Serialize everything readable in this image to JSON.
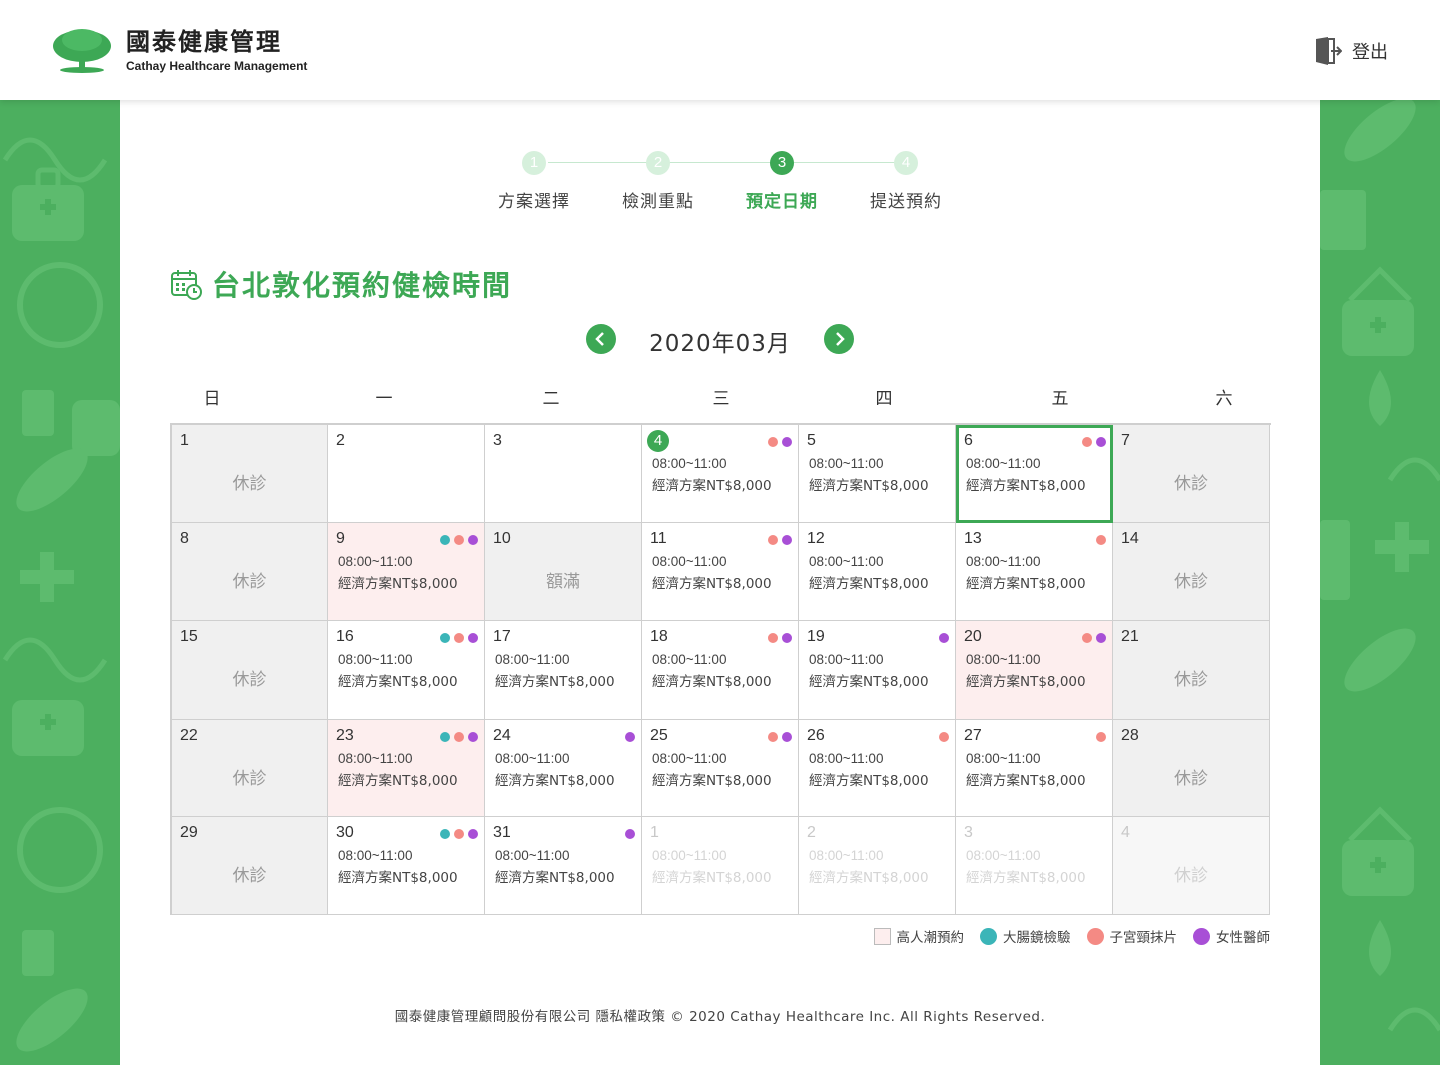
{
  "header": {
    "logo_zh": "國泰健康管理",
    "logo_en": "Cathay Healthcare Management",
    "logout_label": "登出"
  },
  "steps": [
    {
      "num": "1",
      "label": "方案選擇",
      "active": false
    },
    {
      "num": "2",
      "label": "檢測重點",
      "active": false
    },
    {
      "num": "3",
      "label": "預定日期",
      "active": true
    },
    {
      "num": "4",
      "label": "提送預約",
      "active": false
    }
  ],
  "title": "台北敦化預約健檢時間",
  "month_label": "2020年03月",
  "weekdays": [
    "日",
    "一",
    "二",
    "三",
    "四",
    "五",
    "六"
  ],
  "colors": {
    "accent": "#3da855",
    "teal": "#3bb5b8",
    "salmon": "#f48a84",
    "purple": "#a84fd6",
    "crowd": "#fdeeee",
    "closed": "#f0f0f0"
  },
  "calendar": {
    "closed_label": "休診",
    "full_label": "額滿",
    "cells": [
      {
        "day": "1",
        "type": "closed"
      },
      {
        "day": "2",
        "type": "empty"
      },
      {
        "day": "3",
        "type": "empty"
      },
      {
        "day": "4",
        "type": "slot",
        "today": true,
        "dots": [
          "salmon",
          "purple"
        ],
        "time": "08:00~11:00",
        "plan": "經濟方案NT$8,000"
      },
      {
        "day": "5",
        "type": "slot",
        "dots": [],
        "time": "08:00~11:00",
        "plan": "經濟方案NT$8,000"
      },
      {
        "day": "6",
        "type": "slot",
        "selected": true,
        "dots": [
          "salmon",
          "purple"
        ],
        "time": "08:00~11:00",
        "plan": "經濟方案NT$8,000"
      },
      {
        "day": "7",
        "type": "closed"
      },
      {
        "day": "8",
        "type": "closed"
      },
      {
        "day": "9",
        "type": "slot",
        "crowd": true,
        "dots": [
          "teal",
          "salmon",
          "purple"
        ],
        "time": "08:00~11:00",
        "plan": "經濟方案NT$8,000"
      },
      {
        "day": "10",
        "type": "full"
      },
      {
        "day": "11",
        "type": "slot",
        "dots": [
          "salmon",
          "purple"
        ],
        "time": "08:00~11:00",
        "plan": "經濟方案NT$8,000"
      },
      {
        "day": "12",
        "type": "slot",
        "dots": [],
        "time": "08:00~11:00",
        "plan": "經濟方案NT$8,000"
      },
      {
        "day": "13",
        "type": "slot",
        "dots": [
          "salmon"
        ],
        "time": "08:00~11:00",
        "plan": "經濟方案NT$8,000"
      },
      {
        "day": "14",
        "type": "closed"
      },
      {
        "day": "15",
        "type": "closed"
      },
      {
        "day": "16",
        "type": "slot",
        "dots": [
          "teal",
          "salmon",
          "purple"
        ],
        "time": "08:00~11:00",
        "plan": "經濟方案NT$8,000"
      },
      {
        "day": "17",
        "type": "slot",
        "dots": [],
        "time": "08:00~11:00",
        "plan": "經濟方案NT$8,000"
      },
      {
        "day": "18",
        "type": "slot",
        "dots": [
          "salmon",
          "purple"
        ],
        "time": "08:00~11:00",
        "plan": "經濟方案NT$8,000"
      },
      {
        "day": "19",
        "type": "slot",
        "dots": [
          "purple"
        ],
        "time": "08:00~11:00",
        "plan": "經濟方案NT$8,000"
      },
      {
        "day": "20",
        "type": "slot",
        "crowd": true,
        "dots": [
          "salmon",
          "purple"
        ],
        "time": "08:00~11:00",
        "plan": "經濟方案NT$8,000"
      },
      {
        "day": "21",
        "type": "closed"
      },
      {
        "day": "22",
        "type": "closed"
      },
      {
        "day": "23",
        "type": "slot",
        "crowd": true,
        "dots": [
          "teal",
          "salmon",
          "purple"
        ],
        "time": "08:00~11:00",
        "plan": "經濟方案NT$8,000"
      },
      {
        "day": "24",
        "type": "slot",
        "dots": [
          "purple"
        ],
        "time": "08:00~11:00",
        "plan": "經濟方案NT$8,000"
      },
      {
        "day": "25",
        "type": "slot",
        "dots": [
          "salmon",
          "purple"
        ],
        "time": "08:00~11:00",
        "plan": "經濟方案NT$8,000"
      },
      {
        "day": "26",
        "type": "slot",
        "dots": [
          "salmon"
        ],
        "time": "08:00~11:00",
        "plan": "經濟方案NT$8,000"
      },
      {
        "day": "27",
        "type": "slot",
        "dots": [
          "salmon"
        ],
        "time": "08:00~11:00",
        "plan": "經濟方案NT$8,000"
      },
      {
        "day": "28",
        "type": "closed"
      },
      {
        "day": "29",
        "type": "closed"
      },
      {
        "day": "30",
        "type": "slot",
        "dots": [
          "teal",
          "salmon",
          "purple"
        ],
        "time": "08:00~11:00",
        "plan": "經濟方案NT$8,000"
      },
      {
        "day": "31",
        "type": "slot",
        "dots": [
          "purple"
        ],
        "time": "08:00~11:00",
        "plan": "經濟方案NT$8,000"
      },
      {
        "day": "1",
        "type": "next",
        "dots": [],
        "time": "08:00~11:00",
        "plan": "經濟方案NT$8,000"
      },
      {
        "day": "2",
        "type": "next",
        "dots": [],
        "time": "08:00~11:00",
        "plan": "經濟方案NT$8,000"
      },
      {
        "day": "3",
        "type": "next",
        "dots": [],
        "time": "08:00~11:00",
        "plan": "經濟方案NT$8,000"
      },
      {
        "day": "4",
        "type": "next-closed"
      }
    ]
  },
  "legend": [
    {
      "kind": "box",
      "color": "crowd",
      "label": "高人潮預約"
    },
    {
      "kind": "circle",
      "color": "teal",
      "label": "大腸鏡檢驗"
    },
    {
      "kind": "circle",
      "color": "salmon",
      "label": "子宮頸抹片"
    },
    {
      "kind": "circle",
      "color": "purple",
      "label": "女性醫師"
    }
  ],
  "footer": "國泰健康管理顧問股份有限公司 隱私權政策 © 2020 Cathay Healthcare Inc. All Rights Reserved."
}
